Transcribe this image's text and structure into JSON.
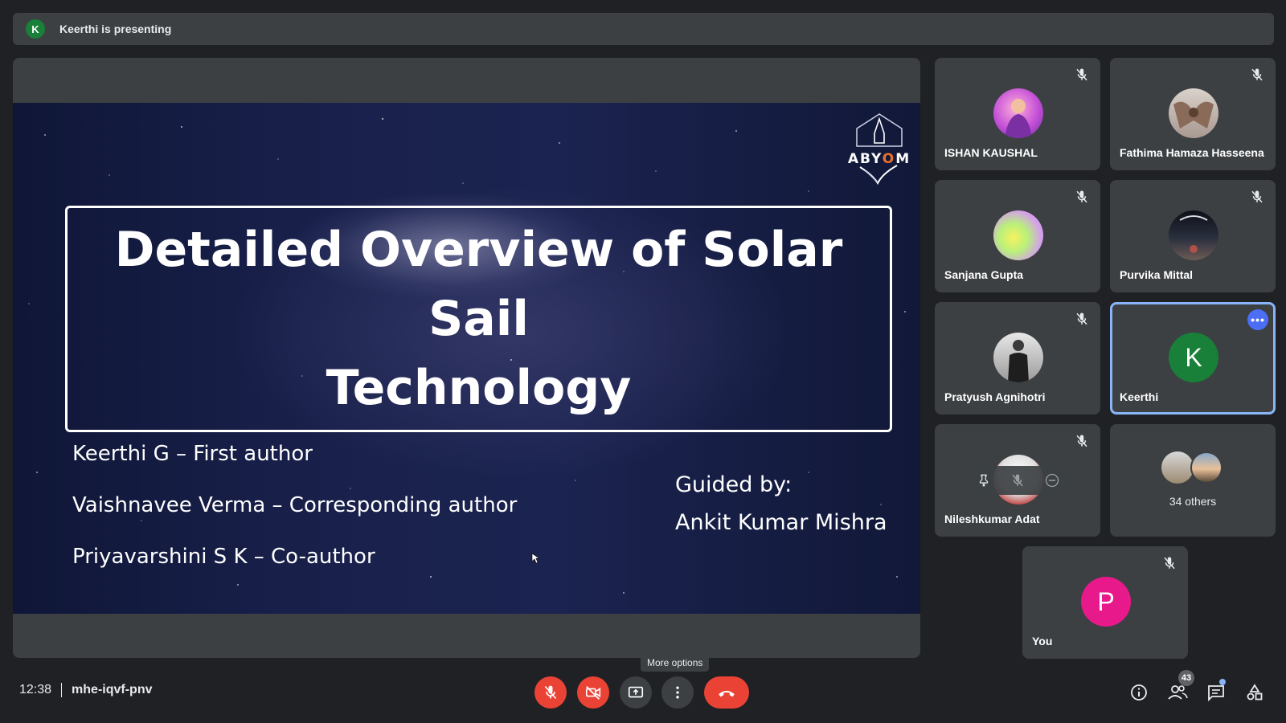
{
  "presenter_bar": {
    "initial": "K",
    "text": "Keerthi is presenting"
  },
  "slide": {
    "logo": {
      "text_a": "ABY",
      "text_o": "O",
      "text_m": "M"
    },
    "title_line1": "Detailed Overview of Solar Sail",
    "title_line2": "Technology",
    "authors": [
      "Keerthi G – First author",
      "Vaishnavee Verma – Corresponding author",
      "Priyavarshini S K – Co-author"
    ],
    "guided_label": "Guided by:",
    "guide_name": "Ankit Kumar Mishra"
  },
  "participants": [
    {
      "name": "ISHAN KAUSHAL",
      "muted": true
    },
    {
      "name": "Fathima Hamaza Hasseena",
      "muted": true
    },
    {
      "name": "Sanjana Gupta",
      "muted": true
    },
    {
      "name": "Purvika Mittal",
      "muted": true
    },
    {
      "name": "Pratyush Agnihotri",
      "muted": true
    },
    {
      "name": "Keerthi",
      "initial": "K",
      "muted": false,
      "active": true
    },
    {
      "name": "Nileshkumar Adat",
      "muted": true
    },
    {
      "name": "You",
      "initial": "P",
      "muted": true
    }
  ],
  "others": {
    "label": "34 others"
  },
  "bottom_bar": {
    "time": "12:38",
    "meeting_code": "mhe-iqvf-pnv",
    "tooltip": "More options",
    "participant_count": "43"
  },
  "colors": {
    "background": "#202124",
    "tile": "#3c4043",
    "danger": "#ea4335",
    "active_border": "#8ab4f8",
    "keerthi_avatar": "#188038",
    "you_avatar": "#e8198b"
  }
}
